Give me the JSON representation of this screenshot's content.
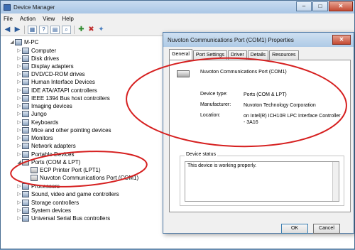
{
  "window": {
    "title": "Device Manager",
    "controls": [
      "–",
      "□",
      "✕"
    ]
  },
  "menu": [
    "File",
    "Action",
    "View",
    "Help"
  ],
  "toolbar": [
    "back-icon",
    "forward-icon",
    "properties-icon",
    "help-icon",
    "update-icon",
    "scan-icon",
    "uninstall-icon",
    "disable-icon",
    "enable-icon"
  ],
  "tree": {
    "root": "M-PC",
    "items": [
      {
        "label": "Computer",
        "icon": "computer-icon"
      },
      {
        "label": "Disk drives",
        "icon": "disk-icon"
      },
      {
        "label": "Display adapters",
        "icon": "display-icon"
      },
      {
        "label": "DVD/CD-ROM drives",
        "icon": "cdrom-icon"
      },
      {
        "label": "Human Interface Devices",
        "icon": "hid-icon"
      },
      {
        "label": "IDE ATA/ATAPI controllers",
        "icon": "ide-icon"
      },
      {
        "label": "IEEE 1394 Bus host controllers",
        "icon": "firewire-icon"
      },
      {
        "label": "Imaging devices",
        "icon": "camera-icon"
      },
      {
        "label": "Jungo",
        "icon": "jungo-icon"
      },
      {
        "label": "Keyboards",
        "icon": "keyboard-icon"
      },
      {
        "label": "Mice and other pointing devices",
        "icon": "mouse-icon"
      },
      {
        "label": "Monitors",
        "icon": "monitor-icon"
      },
      {
        "label": "Network adapters",
        "icon": "network-icon"
      },
      {
        "label": "Portable Devices",
        "icon": "portable-icon"
      },
      {
        "label": "Ports (COM & LPT)",
        "icon": "port-icon"
      },
      {
        "label": "ECP Printer Port (LPT1)",
        "icon": "port-icon"
      },
      {
        "label": "Nuvoton Communications Port (COM1)",
        "icon": "port-icon"
      },
      {
        "label": "Processors",
        "icon": "cpu-icon"
      },
      {
        "label": "Sound, video and game controllers",
        "icon": "sound-icon"
      },
      {
        "label": "Storage controllers",
        "icon": "storage-icon"
      },
      {
        "label": "System devices",
        "icon": "system-icon"
      },
      {
        "label": "Universal Serial Bus controllers",
        "icon": "usb-icon"
      }
    ]
  },
  "dialog": {
    "title": "Nuvoton Communications Port (COM1) Properties",
    "close": "✕",
    "tabs": [
      "General",
      "Port Settings",
      "Driver",
      "Details",
      "Resources"
    ],
    "active_tab": "General",
    "device_name": "Nuvoton Communications Port (COM1)",
    "fields": [
      {
        "key": "Device type:",
        "value": "Ports (COM & LPT)"
      },
      {
        "key": "Manufacturer:",
        "value": "Nuvoton Technology Corporation"
      },
      {
        "key": "Location:",
        "value": "on Intel(R) ICH10R LPC Interface Controller - 3A16"
      }
    ],
    "status_label": "Device status",
    "status_text": "This device is working properly.",
    "ok": "OK",
    "cancel": "Cancel"
  },
  "colors": {
    "annotation": "#d62020",
    "title_bar": "#b9d1ea",
    "accent": "#3c7fb1"
  }
}
